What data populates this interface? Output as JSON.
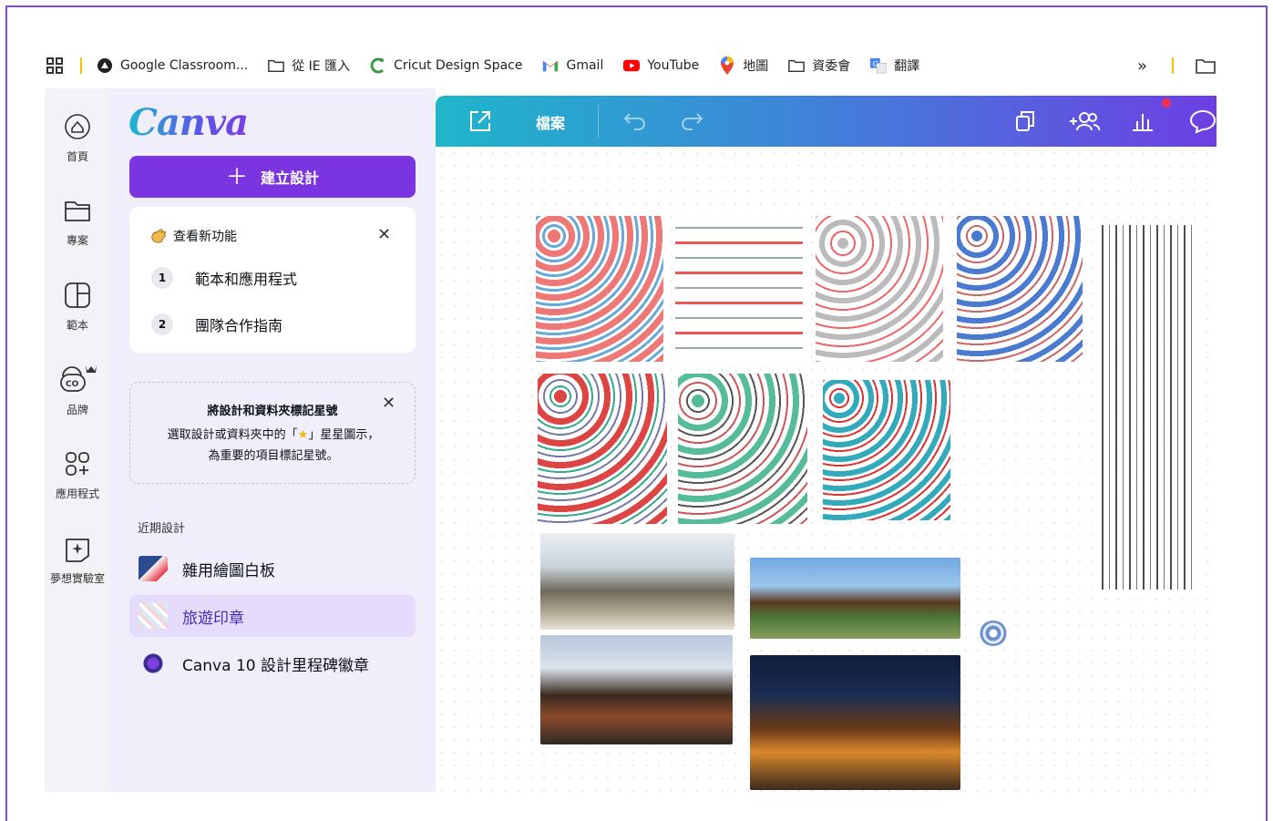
{
  "bookmarks": {
    "items": [
      {
        "label": "Google Classroom...",
        "icon": "classroom-icon"
      },
      {
        "label": "從 IE 匯入",
        "icon": "folder-icon"
      },
      {
        "label": "Cricut Design Space",
        "icon": "cricut-icon"
      },
      {
        "label": "Gmail",
        "icon": "gmail-icon"
      },
      {
        "label": "YouTube",
        "icon": "youtube-icon"
      },
      {
        "label": "地圖",
        "icon": "maps-pin-icon"
      },
      {
        "label": "資委會",
        "icon": "folder-icon"
      },
      {
        "label": "翻譯",
        "icon": "translate-icon"
      }
    ],
    "overflow": "»"
  },
  "rail": [
    {
      "label": "首頁",
      "icon": "home-icon"
    },
    {
      "label": "專案",
      "icon": "folder-icon"
    },
    {
      "label": "範本",
      "icon": "template-icon"
    },
    {
      "label": "品牌",
      "icon": "brand-icon"
    },
    {
      "label": "應用程式",
      "icon": "apps-icon"
    },
    {
      "label": "夢想實驗室",
      "icon": "magic-lab-icon"
    }
  ],
  "panel": {
    "logo": "Canva",
    "create_label": "建立設計",
    "whats_new": {
      "title": "查看新功能",
      "steps": [
        {
          "num": "1",
          "label": "範本和應用程式"
        },
        {
          "num": "2",
          "label": "團隊合作指南"
        }
      ]
    },
    "star_tip": {
      "title": "將設計和資料夾標記星號",
      "body_1": "選取設計或資料夾中的「",
      "body_2": "」星星圖示，",
      "body_3": "為重要的項目標記星號。"
    },
    "recent_label": "近期設計",
    "recent": [
      {
        "label": "雜用繪圖白板",
        "active": false
      },
      {
        "label": "旅遊印章",
        "active": true
      },
      {
        "label": "Canva 10 設計里程碑徽章",
        "active": false
      }
    ]
  },
  "editor": {
    "file_label": "檔案"
  },
  "colors": {
    "accent": "#7b35e0",
    "frame": "#7b4fc1",
    "topbar_start": "#1fb6ca",
    "topbar_end": "#6d3fe3"
  }
}
